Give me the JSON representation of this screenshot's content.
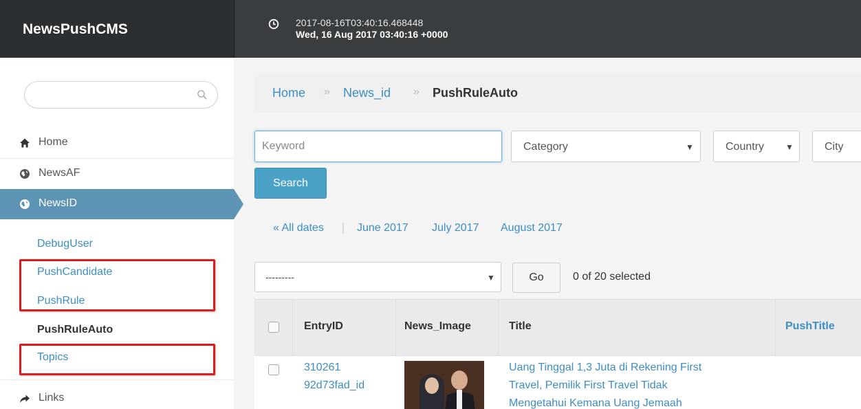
{
  "brand": {
    "name": "NewsPushCMS"
  },
  "header": {
    "timestamp_iso": "2017-08-16T03:40:16.468448",
    "timestamp_rfc": "Wed, 16 Aug 2017 03:40:16 +0000"
  },
  "sidebar": {
    "search_placeholder": "",
    "items": [
      {
        "label": "Home",
        "icon": "home-icon"
      },
      {
        "label": "NewsAF",
        "icon": "globe-icon"
      },
      {
        "label": "NewsID",
        "icon": "globe-icon",
        "active": true
      },
      {
        "label": "Links",
        "icon": "share-icon"
      }
    ],
    "subitems": [
      {
        "label": "DebugUser"
      },
      {
        "label": "PushCandidate",
        "highlighted": true
      },
      {
        "label": "PushRule",
        "highlighted": true
      },
      {
        "label": "PushRuleAuto",
        "current": true
      },
      {
        "label": "Topics",
        "highlighted": true
      }
    ]
  },
  "breadcrumb": {
    "items": [
      "Home",
      "News_id",
      "PushRuleAuto"
    ],
    "separator": "»"
  },
  "filters": {
    "keyword_placeholder": "Keyword",
    "category": "Category",
    "country": "Country",
    "city": "City",
    "search_label": "Search"
  },
  "date_filter": {
    "all_dates": "« All dates",
    "items": [
      "June 2017",
      "July 2017",
      "August 2017"
    ]
  },
  "actions": {
    "select_value": "---------",
    "go_label": "Go",
    "selected_count": "0 of 20 selected"
  },
  "table": {
    "headers": [
      "EntryID",
      "News_Image",
      "Title",
      "PushTitle"
    ],
    "rows": [
      {
        "entry_id_line1": "310261",
        "entry_id_line2": "92d73fad_id",
        "title_line1": "Uang Tinggal 1,3 Juta di Rekening First",
        "title_line2": "Travel, Pemilik First Travel Tidak",
        "title_line3": "Mengetahui Kemana Uang Jemaah"
      }
    ]
  },
  "colors": {
    "topbar": "#3a3d3f",
    "brand_bg": "#2c2f31",
    "active_nav": "#5d93b3",
    "link": "#3d8ec2",
    "search_button": "#4aa2c7",
    "annotation_red": "#e01b1b"
  }
}
